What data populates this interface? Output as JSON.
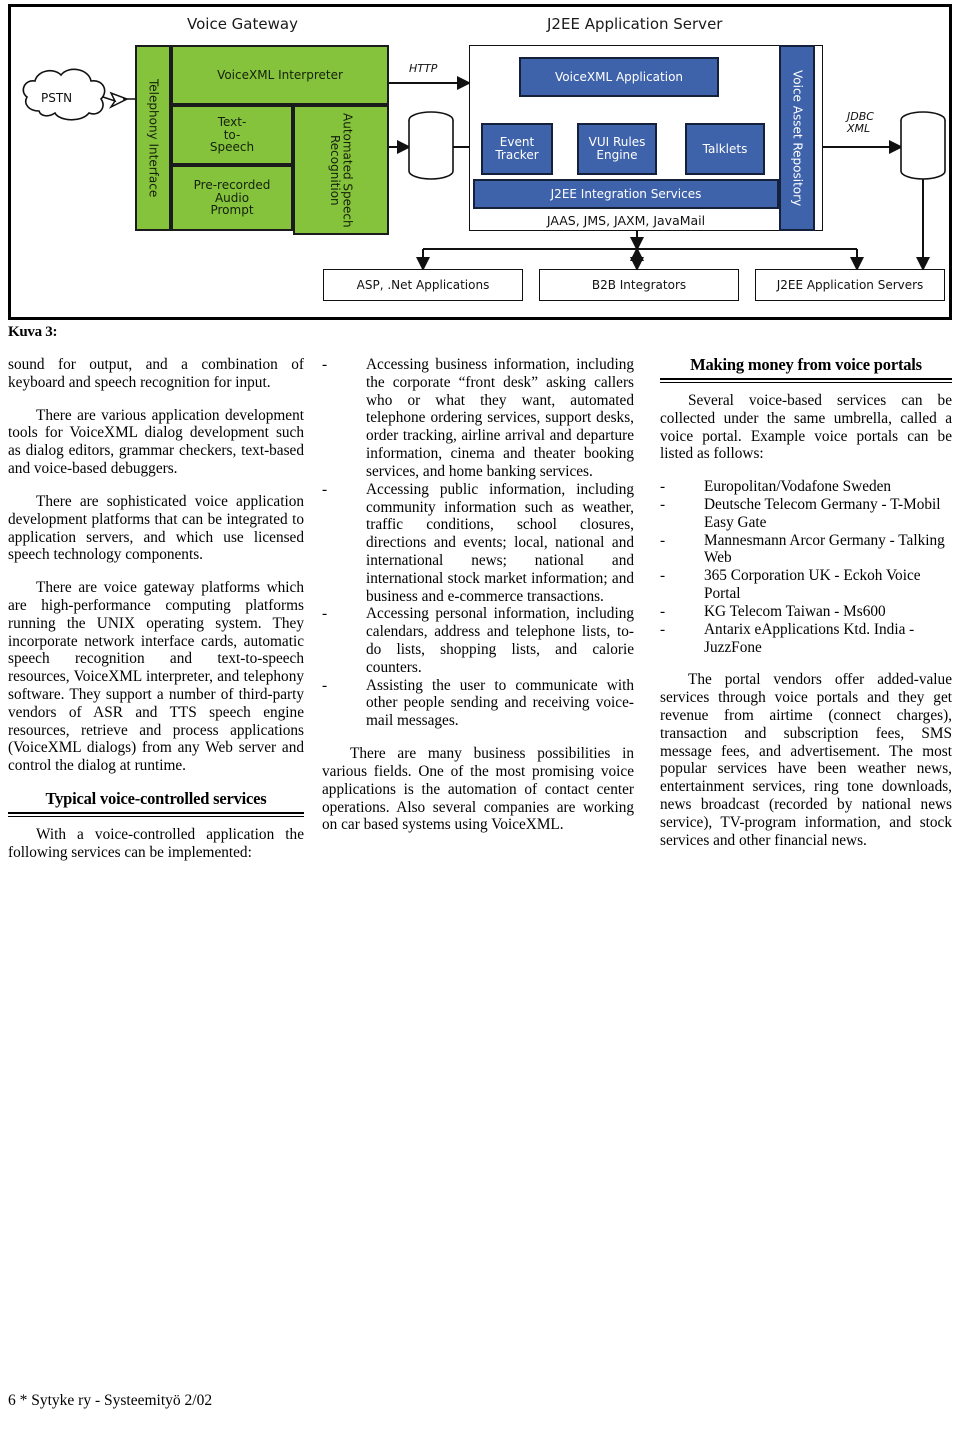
{
  "figure": {
    "caption": "Kuva 3:",
    "titles": {
      "voice_gateway": "Voice Gateway",
      "j2ee_app_server": "J2EE Application Server"
    },
    "cloud": "PSTN",
    "gateway": {
      "telephony_interface": "Telephony Interface",
      "voicexml_interpreter": "VoiceXML Interpreter",
      "text_to_speech": "Text-\nto-\nSpeech",
      "prerecorded_audio_prompt": "Pre-recorded\nAudio\nPrompt",
      "automated_speech_recognition": "Automated Speech Recognition"
    },
    "connectors": {
      "http": "HTTP",
      "jdbc_xml": "JDBC\nXML"
    },
    "server": {
      "voicexml_application": "VoiceXML Application",
      "event_tracker": "Event\nTracker",
      "vui_rules_engine": "VUI Rules\nEngine",
      "talklets": "Talklets",
      "j2ee_integration_services": "J2EE Integration Services",
      "java_apis": "JAAS, JMS, JAXM, JavaMail",
      "voice_asset_repository": "Voice Asset Repository"
    },
    "bottom_boxes": [
      "ASP, .Net Applications",
      "B2B Integrators",
      "J2EE Application Servers"
    ],
    "colors": {
      "green": "#86c33c",
      "blue": "#3f63ab",
      "outline": "#111111",
      "white": "#ffffff"
    }
  },
  "col1": {
    "para_continued": "sound for output, and a combination of keyboard and speech recognition for input.",
    "para_2": "There are various application development tools for VoiceXML dialog development such as dialog editors, grammar checkers, text-based and voice-based debuggers.",
    "para_3": "There are sophisticated voice application development platforms that can be integrated to application servers, and which use licensed speech technology components.",
    "para_4": "There are voice gateway platforms which are high-performance computing platforms running the UNIX operating system. They incorporate network interface cards, automatic speech recognition and text-to-speech resources, VoiceXML interpreter, and telephony software. They support a number of third-party vendors of ASR and TTS speech engine resources, retrieve and process applications (VoiceXML dialogs) from any Web server and control the dialog at runtime.",
    "heading": "Typical voice-controlled services",
    "para_5": "With a voice-controlled application the following services can be implemented:"
  },
  "col2": {
    "dash": "-",
    "bullets": [
      "Accessing business information, including the corporate “front desk” asking callers who or what they want, automated telephone ordering services, support desks, order tracking, airline arrival and departure information, cinema and theater booking services, and home banking services.",
      "Accessing public information, including community information such as weather, traffic conditions, school closures, directions and events; local, national and international news; national and international stock market information; and business and e-commerce transactions.",
      "Accessing personal information, including calendars, address and telephone lists, to-do lists, shopping lists, and calorie counters.",
      "Assisting the user to communicate with other people sending and receiving voice-mail messages."
    ],
    "closing_para": "There are many business possibilities in various fields. One of the most promising voice applications is the automation of contact center operations. Also several companies are working on car based systems using VoiceXML."
  },
  "col3": {
    "heading": "Making money from voice portals",
    "intro": "Several voice-based services can be collected under the same umbrella, called a voice portal. Example voice portals can be listed as follows:",
    "dash": "-",
    "portals": [
      "Europolitan/Vodafone Sweden",
      "Deutsche Telecom Germany - T-Mobil Easy Gate",
      "Mannesmann Arcor Germany - Talking Web",
      "365 Corporation UK - Eckoh Voice Portal",
      "KG Telecom Taiwan - Ms600",
      "Antarix eApplications Ktd. India - JuzzFone"
    ],
    "closing_para": "The portal vendors offer added-value services through voice portals and they get revenue from airtime (connect charges), transaction and subscription fees, SMS message fees, and advertisement. The most popular services have been weather news, entertainment services, ring tone downloads, news broadcast (recorded by national news service), TV-program information, and stock services and other financial news."
  },
  "footer": {
    "text": "6 * Sytyke ry - Systeemityö 2/02"
  }
}
